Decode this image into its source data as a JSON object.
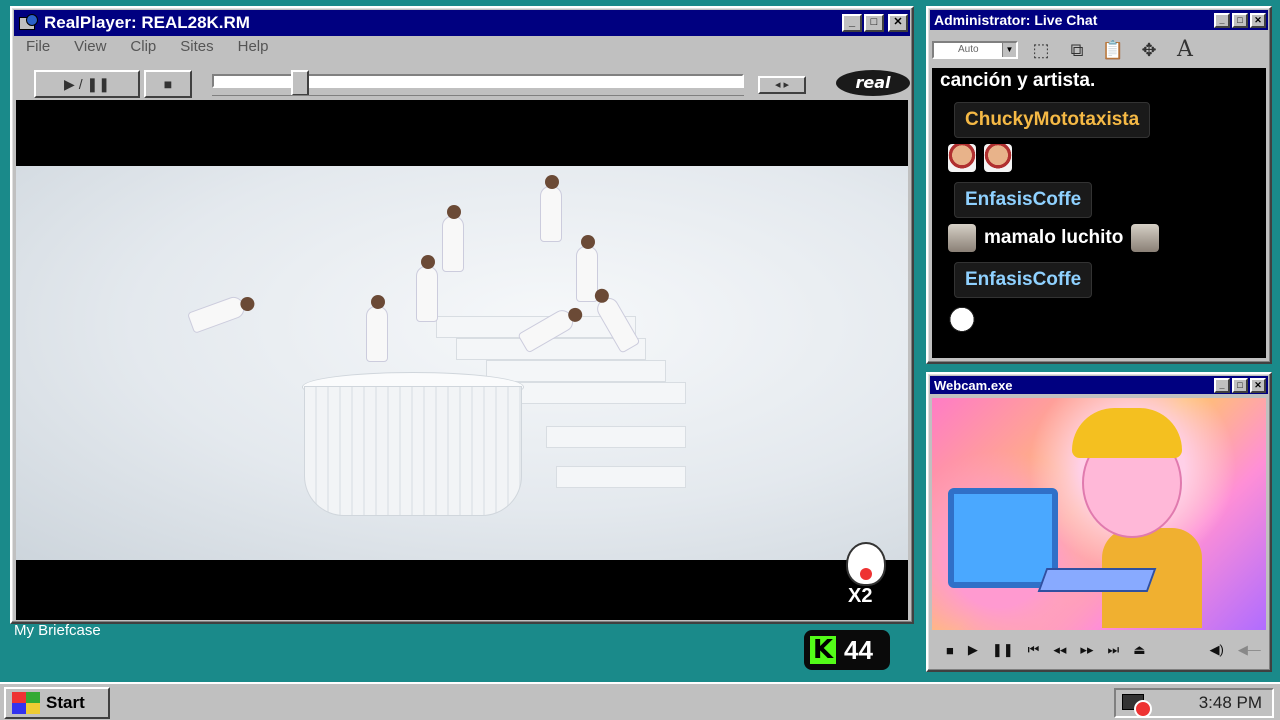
{
  "realplayer": {
    "title": "RealPlayer: REAL28K.RM",
    "menu": [
      "File",
      "View",
      "Clip",
      "Sites",
      "Help"
    ],
    "play_pause": "▶ / ❚❚",
    "stop": "■",
    "prev_next": "◂ ▸",
    "brand": "real",
    "seek_position": 0.15,
    "overlay_badge": "X2"
  },
  "chat": {
    "title": "Administrator: Live Chat",
    "font_select": "Auto",
    "messages": [
      {
        "type": "text",
        "text": "canción y artista."
      },
      {
        "type": "user",
        "name": "ChuckyMototaxista",
        "color": "#f5b945"
      },
      {
        "type": "emotes"
      },
      {
        "type": "user",
        "name": "EnfasisCoffe",
        "color": "#8fd1ff"
      },
      {
        "type": "msg",
        "text": "mamalo luchito"
      },
      {
        "type": "user",
        "name": "EnfasisCoffe",
        "color": "#8fd1ff"
      }
    ]
  },
  "webcam": {
    "title": "Webcam.exe",
    "controls": [
      "■",
      "▶",
      "❚❚",
      "⏮",
      "◂◂",
      "▸▸",
      "⏭",
      "⏏",
      "◀)",
      "◀—"
    ]
  },
  "desktop": {
    "label": "My Briefcase",
    "kick_logo": "K",
    "kick_count": "44"
  },
  "taskbar": {
    "start": "Start",
    "clock": "3:48 PM"
  },
  "colors": {
    "desktop": "#1a8a8a",
    "titlebar": "#000080",
    "kick_green": "#53fc18"
  }
}
